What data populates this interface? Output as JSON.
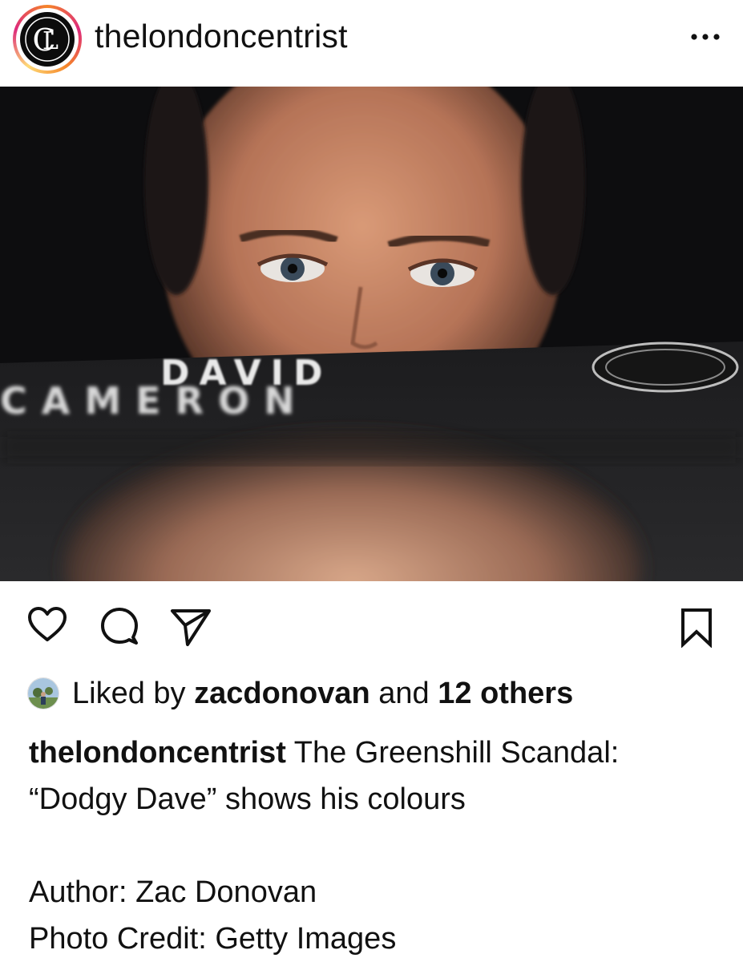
{
  "post": {
    "username": "thelondoncentrist",
    "avatar_logo_text": "LC",
    "more_icon": "more-horizontal-icon"
  },
  "photo": {
    "book_title_line1": "DAVID",
    "book_title_line2": "CAMERON"
  },
  "actions": {
    "like_icon": "heart-icon",
    "comment_icon": "comment-icon",
    "share_icon": "send-icon",
    "save_icon": "bookmark-icon"
  },
  "likes": {
    "prefix": "Liked by",
    "user": "zacdonovan",
    "joiner": "and",
    "others": "12 others"
  },
  "caption": {
    "username": "thelondoncentrist",
    "line1_text": "The Greenshill Scandal:",
    "line2_text": "“Dodgy Dave” shows his colours",
    "author": "Author: Zac Donovan",
    "credit": "Photo Credit: Getty Images"
  }
}
